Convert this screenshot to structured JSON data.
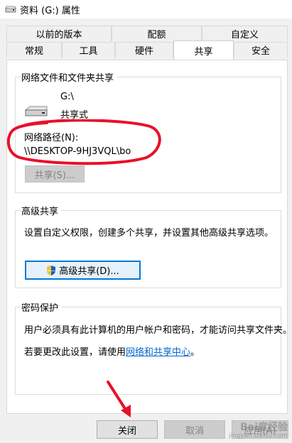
{
  "window": {
    "title": "资料 (G:) 属性"
  },
  "tabs": {
    "row1": [
      "以前的版本",
      "配额",
      "自定义"
    ],
    "row2": [
      "常规",
      "工具",
      "硬件",
      "共享",
      "安全"
    ],
    "active": "共享"
  },
  "network_share": {
    "group_title": "网络文件和文件夹共享",
    "drive_name": "G:\\",
    "drive_status": "共享式",
    "path_label": "网络路径(N):",
    "path_value": "\\\\DESKTOP-9HJ3VQL\\bo",
    "share_button": "共享(S)..."
  },
  "advanced_share": {
    "group_title": "高级共享",
    "description": "设置自定义权限，创建多个共享，并设置其他高级共享选项。",
    "button": "高级共享(D)..."
  },
  "password": {
    "group_title": "密码保护",
    "description": "用户必须具有此计算机的用户帐户和密码，才能访问共享文件夹。",
    "change_prefix": "若要更改此设置，请使用",
    "link": "网络和共享中心",
    "change_suffix": "。"
  },
  "footer": {
    "ok": "关闭",
    "cancel": "取消",
    "apply": "应用(A)"
  },
  "watermark": {
    "brand": "Bai度经验",
    "url": "jingyan.baidu.com"
  },
  "colors": {
    "annotation_red": "#e8102a",
    "link_blue": "#0066cc",
    "focus_blue": "#0078d7"
  }
}
